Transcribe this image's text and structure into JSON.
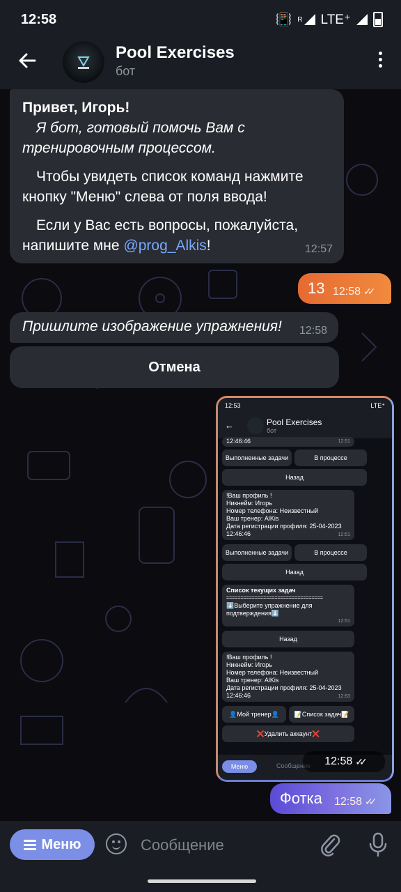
{
  "status": {
    "time": "12:58",
    "network": "LTE⁺",
    "roaming": "R"
  },
  "header": {
    "title": "Pool Exercises",
    "subtitle": "бот"
  },
  "messages": {
    "welcome": {
      "greeting": "Привет, Игорь!",
      "line1": "Я бот, готовый помочь Вам с тренировочным процессом.",
      "line2": "Чтобы увидеть список команд нажмите кнопку \"Меню\" слева от поля ввода!",
      "line3_prefix": "Если у Вас есть вопросы, пожалуйста, напишите мне ",
      "line3_link": "@prog_Alkis",
      "line3_suffix": "!",
      "time": "12:57"
    },
    "out_13": {
      "text": "13",
      "time": "12:58"
    },
    "prompt": {
      "text": "Пришлите изображение упражнения!",
      "time": "12:58"
    },
    "cancel_button": "Отмена",
    "photo_time": "12:58",
    "out_photo": {
      "text": "Фотка",
      "time": "12:58"
    }
  },
  "screenshot": {
    "status_time": "12:53",
    "status_net": "LTE⁺",
    "title": "Pool Exercises",
    "subtitle": "бот",
    "top_time": "12:46:46",
    "top_ts": "12:51",
    "btn_done": "Выполненные задачи",
    "btn_progress": "В процессе",
    "btn_back": "Назад",
    "profile1": {
      "l1": "!Ваш профиль !",
      "l2": "Никнейм: Игорь",
      "l3": "Номер телефона: Неизвестный",
      "l4": "Ваш тренер: AlKis",
      "l5": "Дата регистрации профиля: 25-04-2023",
      "l6": "12:46:46",
      "ts": "12:51"
    },
    "tasks": {
      "l1": "Список текущих задач",
      "l2": "==================================",
      "l3": "⬇️Выберите упражнение для подтверждения⬇️",
      "ts": "12:51"
    },
    "profile2": {
      "l1": "!Ваш профиль !",
      "l2": "Никнейм: Игорь",
      "l3": "Номер телефона: Неизвестный",
      "l4": "Ваш тренер: AlKis",
      "l5": "Дата регистрации профиля: 25-04-2023",
      "l6": "12:46:46",
      "ts": "12:53"
    },
    "btn_trainer": "👤Мой тренер👤",
    "btn_tasks": "📝Список задач📝",
    "btn_delete": "❌Удалить аккаунт❌",
    "menu": "Меню",
    "placeholder": "Сообщение"
  },
  "input": {
    "menu_label": "Меню",
    "placeholder": "Сообщение"
  },
  "colors": {
    "accent": "#7c8fe6",
    "outgoing": "#ee7d3a",
    "incoming": "#2a2c33",
    "link": "#79a8ff"
  }
}
